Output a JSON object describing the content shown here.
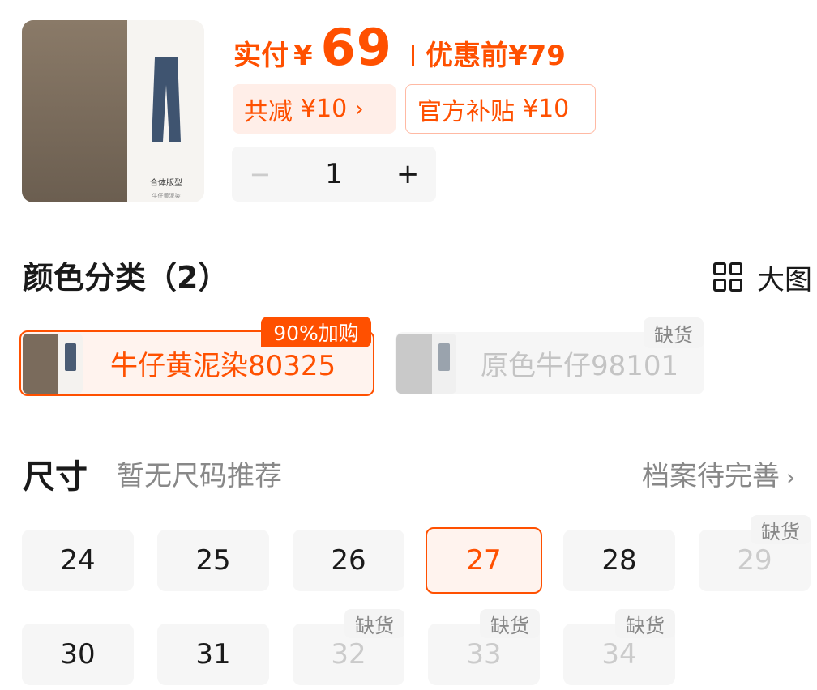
{
  "product": {
    "thumb_caption_1": "合体版型",
    "thumb_caption_2": "牛仔黄泥染"
  },
  "price": {
    "paid_label": "实付",
    "currency": "¥",
    "paid_value": "69",
    "orig_label": "优惠前",
    "orig_value": "¥79"
  },
  "discount": {
    "total_label": "共减",
    "total_value": "¥10",
    "arrow": "›",
    "subsidy_label": "官方补贴",
    "subsidy_value": "¥10"
  },
  "quantity": {
    "minus": "−",
    "value": "1",
    "plus": "+"
  },
  "color_section": {
    "title": "颜色分类（2）",
    "big_view_label": "大图",
    "promo_tag": "90%加购",
    "options": [
      {
        "name": "牛仔黄泥染80325",
        "selected": true
      },
      {
        "name": "原色牛仔98101",
        "out_of_stock": true,
        "tag": "缺货"
      }
    ]
  },
  "size_section": {
    "title": "尺寸",
    "hint": "暂无尺码推荐",
    "profile_link": "档案待完善",
    "chevron": "›",
    "oos_label": "缺货",
    "sizes": [
      "24",
      "25",
      "26",
      "27",
      "28",
      "29",
      "30",
      "31",
      "32",
      "33",
      "34"
    ],
    "selected": "27",
    "out_of_stock": [
      "29",
      "32",
      "33",
      "34"
    ]
  },
  "colors": {
    "accent": "#ff5000",
    "accent_bg": "#fff3ee",
    "chip_bg": "#f6f6f6",
    "muted_text": "#888888"
  }
}
